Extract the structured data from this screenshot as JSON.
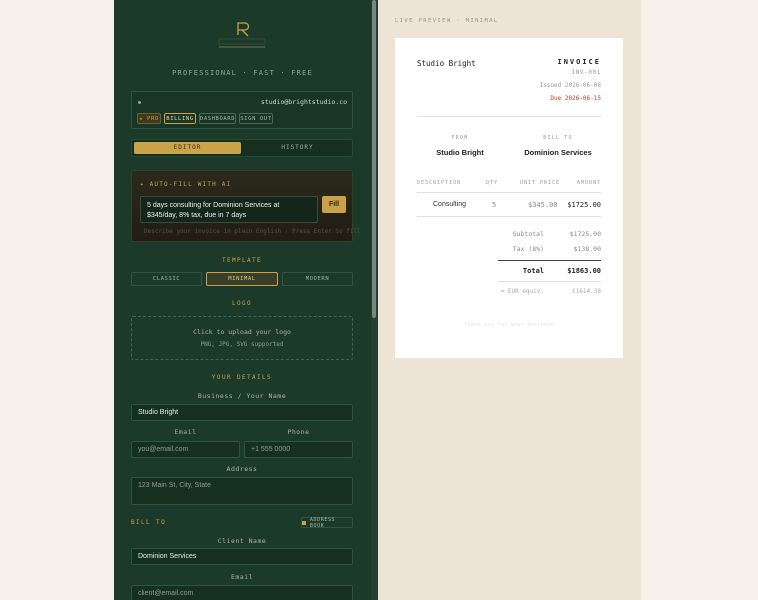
{
  "brand": {
    "tagline": "PROFESSIONAL · FAST · FREE"
  },
  "account": {
    "email": "studio@brightstudio.co",
    "pro_badge": "★ PRO",
    "billing": "BILLING",
    "dashboard": "DASHBOARD",
    "signout": "SIGN OUT"
  },
  "tabs": {
    "editor": "EDITOR",
    "history": "HISTORY"
  },
  "ai": {
    "heading": "✦ AUTO-FILL WITH AI",
    "prompt": "5 days consulting for Dominion Services at $345/day, 8% tax, due in 7 days",
    "fill": "Fill",
    "hint": "Describe your invoice in plain English · Press Enter to fill"
  },
  "template": {
    "heading": "TEMPLATE",
    "options": [
      "CLASSIC",
      "MINIMAL",
      "MODERN"
    ],
    "selected": "MINIMAL"
  },
  "logo": {
    "heading": "LOGO",
    "upload": "Click to upload your logo",
    "formats": "PNG, JPG, SVG supported"
  },
  "details": {
    "heading": "YOUR DETAILS",
    "name_label": "Business / Your Name",
    "name_value": "Studio Bright",
    "email_label": "Email",
    "email_ph": "you@email.com",
    "phone_label": "Phone",
    "phone_ph": "+1 555 0000",
    "address_label": "Address",
    "address_ph": "123 Main St, City, State"
  },
  "billto": {
    "heading": "BILL TO",
    "address_book": "ADDRESS BOOK",
    "client_label": "Client Name",
    "client_value": "Dominion Services",
    "email_label": "Email",
    "email_ph": "client@email.com"
  },
  "preview": {
    "heading": "LIVE PREVIEW · MINIMAL",
    "company": "Studio Bright",
    "title": "INVOICE",
    "number": "INV-001",
    "issued": "Issued 2026-06-08",
    "due": "Due 2026-06-15",
    "from_label": "FROM",
    "from_value": "Studio Bright",
    "billto_label": "BILL TO",
    "billto_value": "Dominion Services",
    "columns": [
      "DESCRIPTION",
      "QTY",
      "UNIT PRICE",
      "AMOUNT"
    ],
    "row": {
      "desc": "Consulting",
      "qty": "5",
      "unit": "$345.00",
      "amount": "$1725.00"
    },
    "subtotal_label": "Subtotal",
    "subtotal": "$1725.00",
    "tax_label": "Tax (8%)",
    "tax": "$138.00",
    "total_label": "Total",
    "total": "$1863.00",
    "fx_label": "≈ EUR equiv.",
    "fx": "€1614.38",
    "thanks": "Thank you for your business"
  },
  "colors": {
    "panel": "#1c3a2a",
    "accent": "#c9a24a",
    "due": "#c0392b"
  }
}
